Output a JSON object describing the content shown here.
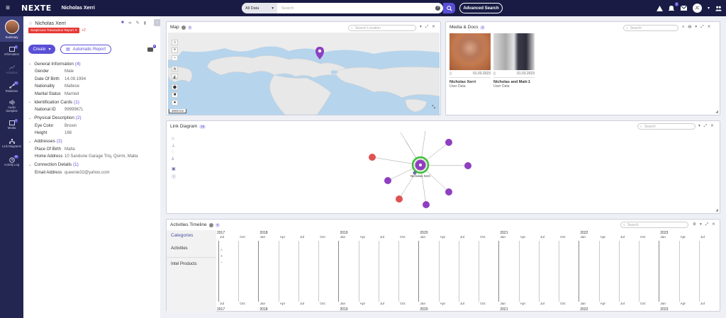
{
  "topbar": {
    "logo": "NEXTE",
    "profile_name": "Nicholas Xerri",
    "search_category": "All Data",
    "search_placeholder": "Search",
    "advanced_search": "Advanced Search",
    "notif_badge": "5",
    "avatar_initials": "JC"
  },
  "nav": [
    {
      "name": "summary",
      "label": "Summary",
      "badge": "",
      "active": true
    },
    {
      "name": "information",
      "label": "Information",
      "badge": "4",
      "active": false
    },
    {
      "name": "activities",
      "label": "Activities",
      "badge": "",
      "active": false,
      "dim": true
    },
    {
      "name": "relations",
      "label": "Relations",
      "badge": "10",
      "active": false
    },
    {
      "name": "audio-samples",
      "label": "Audio Samples",
      "badge": "",
      "active": false
    },
    {
      "name": "media",
      "label": "Media",
      "badge": "2",
      "active": false
    },
    {
      "name": "link-diagrams",
      "label": "Link Diagrams",
      "badge": "",
      "active": false
    },
    {
      "name": "activity-log",
      "label": "Activity Log",
      "badge": "15",
      "active": false
    }
  ],
  "profile": {
    "name": "Nicholas Xerri",
    "tag": "Suspicious Transaction Report",
    "tag_extra": "+2",
    "create": "Create",
    "auto_report": "Automatic Report",
    "folder_badge": "0",
    "sections": [
      {
        "title": "General Information",
        "count": "(4)",
        "fields": [
          [
            "Gender",
            "Male"
          ],
          [
            "Date Of Birth",
            "14.09.1994"
          ],
          [
            "Nationality",
            "Maltese"
          ],
          [
            "Marital Status",
            "Married"
          ]
        ]
      },
      {
        "title": "Identification Cards",
        "count": "(1)",
        "fields": [
          [
            "National ID",
            "9999967L"
          ]
        ]
      },
      {
        "title": "Physical Description",
        "count": "(2)",
        "fields": [
          [
            "Eye Color",
            "Brown"
          ],
          [
            "Height",
            "168"
          ]
        ]
      },
      {
        "title": "Addresses",
        "count": "(2)",
        "fields": [
          [
            "Place Of Birth",
            "Malta"
          ],
          [
            "Home Address",
            "10 Sandune Garage Triq, Qormi, Malta"
          ]
        ]
      },
      {
        "title": "Connection Details",
        "count": "(1)",
        "fields": [
          [
            "Email Address",
            "queenie32@yahoo.com"
          ]
        ]
      }
    ]
  },
  "map": {
    "title": "Map",
    "count": "1",
    "search_placeholder": "Search Location",
    "scale": "3000 km"
  },
  "media": {
    "title": "Media & Docs",
    "count": "2",
    "search_placeholder": "Search",
    "items": [
      {
        "date": "01.03.2023",
        "name": "Nicholas Xerri",
        "sub": "User Data"
      },
      {
        "date": "01.03.2023",
        "name": "Nicholas and Matt-1",
        "sub": "User Data"
      }
    ]
  },
  "link": {
    "title": "Link Diagram",
    "count": "10",
    "search_placeholder": "Search",
    "center": "Nicholas Xerri"
  },
  "timeline": {
    "title": "Activities Timeline",
    "count": "0",
    "search_placeholder": "Search",
    "categories_header": "Categories",
    "categories": [
      "Activities",
      "Intel Products"
    ],
    "years": [
      "2017",
      "2018",
      "2019",
      "2020",
      "2021",
      "2022",
      "2023"
    ],
    "months": [
      "Jul",
      "Oct",
      "Jan",
      "Apr",
      "Jul",
      "Oct",
      "Jan",
      "Apr",
      "Jul",
      "Oct",
      "Jan",
      "Apr",
      "Jul",
      "Oct",
      "Jan",
      "Apr",
      "Jul",
      "Oct",
      "Jan",
      "Apr",
      "Jul",
      "Oct",
      "Jan",
      "Apr",
      "Jul"
    ]
  }
}
